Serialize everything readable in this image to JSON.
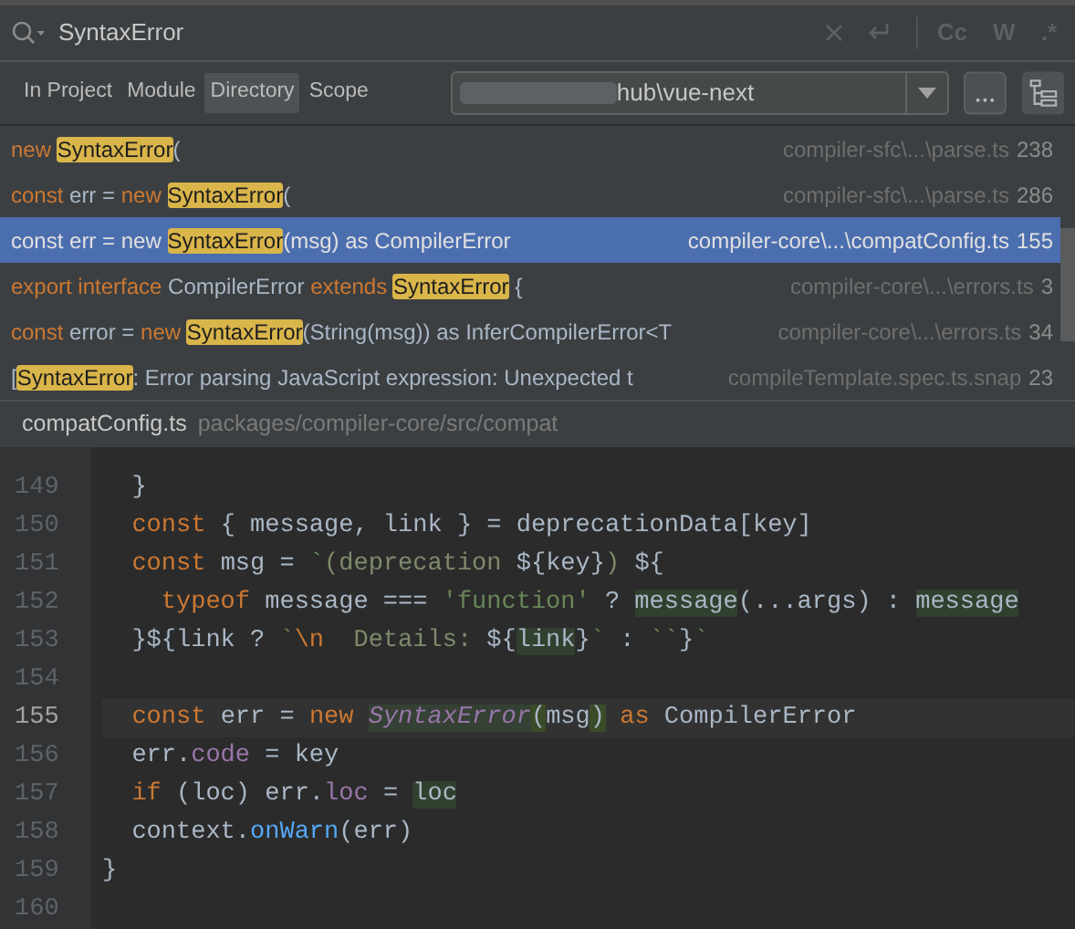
{
  "search": {
    "query": "SyntaxError"
  },
  "toggles": [
    {
      "label": "Cc"
    },
    {
      "label": "W"
    },
    {
      "label": ".*"
    }
  ],
  "scope_tabs": [
    {
      "label": "In Project",
      "selected": false
    },
    {
      "label": "Module",
      "selected": false
    },
    {
      "label": "Directory",
      "selected": true
    },
    {
      "label": "Scope",
      "selected": false
    }
  ],
  "directory": {
    "value": "hub\\vue-next"
  },
  "results": [
    {
      "selected": false,
      "location": "compiler-sfc\\...\\parse.ts",
      "line": "238",
      "segments": [
        {
          "text": "new ",
          "kind": "kw"
        },
        {
          "text": "SyntaxError",
          "kind": "match"
        },
        {
          "text": "(",
          "kind": "plain"
        }
      ]
    },
    {
      "selected": false,
      "location": "compiler-sfc\\...\\parse.ts",
      "line": "286",
      "segments": [
        {
          "text": "const ",
          "kind": "kw"
        },
        {
          "text": "err = ",
          "kind": "plain"
        },
        {
          "text": "new ",
          "kind": "kw"
        },
        {
          "text": "SyntaxError",
          "kind": "match"
        },
        {
          "text": "(",
          "kind": "plain"
        }
      ]
    },
    {
      "selected": true,
      "location": "compiler-core\\...\\compatConfig.ts",
      "line": "155",
      "segments": [
        {
          "text": "const err = new ",
          "kind": "plain"
        },
        {
          "text": "SyntaxError",
          "kind": "match"
        },
        {
          "text": "(msg) as CompilerError",
          "kind": "plain"
        }
      ]
    },
    {
      "selected": false,
      "location": "compiler-core\\...\\errors.ts",
      "line": "3",
      "segments": [
        {
          "text": "export interface ",
          "kind": "kw"
        },
        {
          "text": "CompilerError ",
          "kind": "plain"
        },
        {
          "text": "extends ",
          "kind": "kw"
        },
        {
          "text": "SyntaxError",
          "kind": "match"
        },
        {
          "text": " {",
          "kind": "plain"
        }
      ]
    },
    {
      "selected": false,
      "location": "compiler-core\\...\\errors.ts",
      "line": "34",
      "segments": [
        {
          "text": "const ",
          "kind": "kw"
        },
        {
          "text": "error = ",
          "kind": "plain"
        },
        {
          "text": "new ",
          "kind": "kw"
        },
        {
          "text": "SyntaxError",
          "kind": "match"
        },
        {
          "text": "(String(msg)) as InferCompilerError<T",
          "kind": "plain"
        }
      ]
    },
    {
      "selected": false,
      "location": "compileTemplate.spec.ts.snap",
      "line": "23",
      "segments": [
        {
          "text": "[",
          "kind": "plain"
        },
        {
          "text": "SyntaxError",
          "kind": "match"
        },
        {
          "text": ": Error parsing JavaScript expression: Unexpected t",
          "kind": "plain"
        }
      ]
    }
  ],
  "preview": {
    "file": "compatConfig.ts",
    "path": "packages/compiler-core/src/compat"
  },
  "code": [
    {
      "number": "149",
      "current": false,
      "tokens": [
        {
          "text": "  }",
          "kind": "plain"
        }
      ]
    },
    {
      "number": "150",
      "current": false,
      "tokens": [
        {
          "text": "  const",
          "kind": "kw"
        },
        {
          "text": " { message, link } = deprecationData[key]",
          "kind": "plain"
        }
      ]
    },
    {
      "number": "151",
      "current": false,
      "tokens": [
        {
          "text": "  const",
          "kind": "kw"
        },
        {
          "text": " msg = ",
          "kind": "plain"
        },
        {
          "text": "`",
          "kind": "str"
        },
        {
          "text": "(deprecation ",
          "kind": "tpl"
        },
        {
          "text": "${key}",
          "kind": "plain"
        },
        {
          "text": ") ",
          "kind": "tpl"
        },
        {
          "text": "${",
          "kind": "plain"
        }
      ]
    },
    {
      "number": "152",
      "current": false,
      "tokens": [
        {
          "text": "    typeof",
          "kind": "kw"
        },
        {
          "text": " message === ",
          "kind": "plain"
        },
        {
          "text": "'function'",
          "kind": "str"
        },
        {
          "text": " ? ",
          "kind": "plain"
        },
        {
          "text": "message",
          "kind": "usage"
        },
        {
          "text": "(...args) : ",
          "kind": "plain"
        },
        {
          "text": "message",
          "kind": "usage"
        }
      ]
    },
    {
      "number": "153",
      "current": false,
      "tokens": [
        {
          "text": "  }${link ? ",
          "kind": "plain"
        },
        {
          "text": "`",
          "kind": "str"
        },
        {
          "text": "\\n",
          "kind": "kw"
        },
        {
          "text": "  Details: ",
          "kind": "tpl"
        },
        {
          "text": "${",
          "kind": "plain"
        },
        {
          "text": "link",
          "kind": "usage"
        },
        {
          "text": "}",
          "kind": "plain"
        },
        {
          "text": "`",
          "kind": "str"
        },
        {
          "text": " : ",
          "kind": "plain"
        },
        {
          "text": "``",
          "kind": "str"
        },
        {
          "text": "}",
          "kind": "plain"
        },
        {
          "text": "`",
          "kind": "str"
        }
      ]
    },
    {
      "number": "154",
      "current": false
    },
    {
      "number": "155",
      "current": true,
      "tokens": [
        {
          "text": "  const",
          "kind": "kw"
        },
        {
          "text": " err = ",
          "kind": "plain"
        },
        {
          "text": "new ",
          "kind": "kw"
        },
        {
          "text": "SyntaxError",
          "kind": "cls"
        },
        {
          "text": "(",
          "kind": "brace"
        },
        {
          "text": "msg",
          "kind": "plain"
        },
        {
          "text": ")",
          "kind": "brace"
        },
        {
          "text": " as",
          "kind": "kw"
        },
        {
          "text": " CompilerError",
          "kind": "plain"
        }
      ]
    },
    {
      "number": "156",
      "current": false,
      "tokens": [
        {
          "text": "  err.",
          "kind": "plain"
        },
        {
          "text": "code",
          "kind": "prop"
        },
        {
          "text": " = key",
          "kind": "plain"
        }
      ]
    },
    {
      "number": "157",
      "current": false,
      "tokens": [
        {
          "text": "  if",
          "kind": "kw"
        },
        {
          "text": " (loc) err.",
          "kind": "plain"
        },
        {
          "text": "loc",
          "kind": "prop"
        },
        {
          "text": " = ",
          "kind": "plain"
        },
        {
          "text": "loc",
          "kind": "usage"
        }
      ]
    },
    {
      "number": "158",
      "current": false,
      "tokens": [
        {
          "text": "  context.",
          "kind": "plain"
        },
        {
          "text": "onWarn",
          "kind": "fn"
        },
        {
          "text": "(err)",
          "kind": "plain"
        }
      ]
    },
    {
      "number": "159",
      "current": false,
      "tokens": [
        {
          "text": "}",
          "kind": "plain"
        }
      ]
    },
    {
      "number": "160",
      "current": false
    }
  ]
}
